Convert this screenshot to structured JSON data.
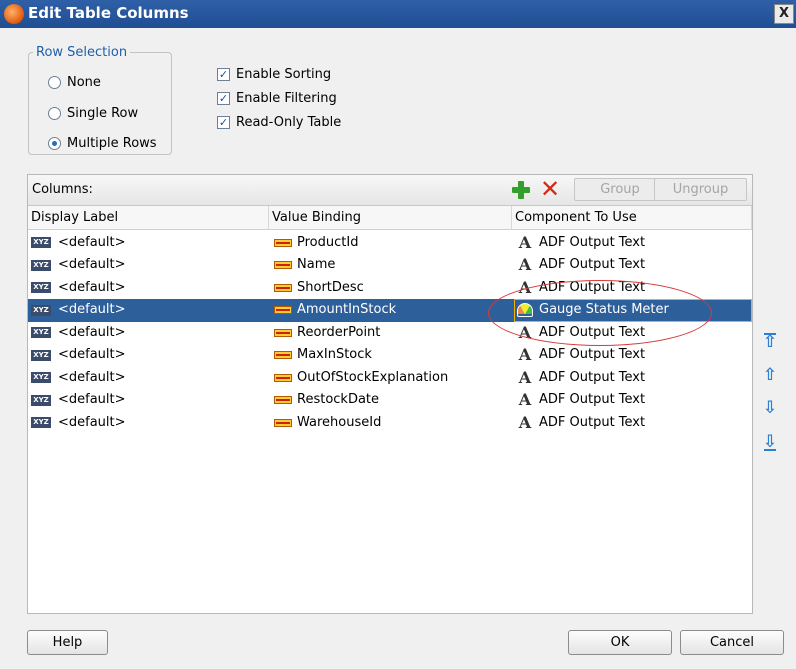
{
  "window": {
    "title": "Edit Table Columns",
    "close_label": "X"
  },
  "row_selection": {
    "legend": "Row Selection",
    "options": [
      {
        "label": "None",
        "selected": false
      },
      {
        "label": "Single Row",
        "selected": false
      },
      {
        "label": "Multiple Rows",
        "selected": true
      }
    ]
  },
  "options": [
    {
      "label": "Enable Sorting",
      "checked": true
    },
    {
      "label": "Enable Filtering",
      "checked": true
    },
    {
      "label": "Read-Only Table",
      "checked": true
    }
  ],
  "columns_panel": {
    "label": "Columns:",
    "add_icon": "add-icon",
    "delete_icon": "delete-icon",
    "group_label": "Group",
    "ungroup_label": "Ungroup",
    "headers": [
      "Display Label",
      "Value Binding",
      "Component To Use"
    ],
    "rows": [
      {
        "display": "<default>",
        "binding": "ProductId",
        "component": "ADF Output Text"
      },
      {
        "display": "<default>",
        "binding": "Name",
        "component": "ADF Output Text"
      },
      {
        "display": "<default>",
        "binding": "ShortDesc",
        "component": "ADF Output Text"
      },
      {
        "display": "<default>",
        "binding": "AmountInStock",
        "component": "Gauge Status Meter",
        "selected": true
      },
      {
        "display": "<default>",
        "binding": "ReorderPoint",
        "component": "ADF Output Text"
      },
      {
        "display": "<default>",
        "binding": "MaxInStock",
        "component": "ADF Output Text"
      },
      {
        "display": "<default>",
        "binding": "OutOfStockExplanation",
        "component": "ADF Output Text"
      },
      {
        "display": "<default>",
        "binding": "RestockDate",
        "component": "ADF Output Text"
      },
      {
        "display": "<default>",
        "binding": "WarehouseId",
        "component": "ADF Output Text"
      }
    ]
  },
  "reorder_icons": [
    "move-top-icon",
    "move-up-icon",
    "move-down-icon",
    "move-bottom-icon"
  ],
  "footer": {
    "help_label": "Help",
    "ok_label": "OK",
    "cancel_label": "Cancel"
  }
}
